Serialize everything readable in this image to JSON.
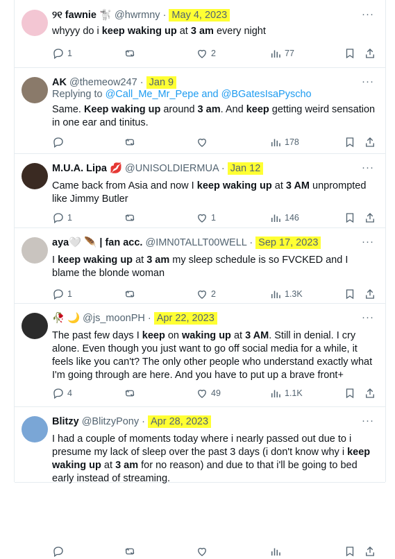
{
  "tweets": [
    {
      "name": "୨୧ fawnie 🐩",
      "handle": "@hwrmny",
      "sep": "·",
      "date": "May 4, 2023",
      "reply_prefix": "",
      "reply_to": "",
      "text": [
        [
          "whyyy do i ",
          false
        ],
        [
          "keep waking up",
          true
        ],
        [
          " at ",
          false
        ],
        [
          "3 am",
          true
        ],
        [
          " every night",
          false
        ]
      ],
      "replies": "1",
      "retweets": "",
      "likes": "2",
      "views": "77",
      "avatar_color": "#f3c6d3"
    },
    {
      "name": "AK",
      "handle": "@themeow247",
      "sep": "·",
      "date": "Jan 9",
      "reply_prefix": "Replying to ",
      "reply_to": "@Call_Me_Mr_Pepe and @BGatesIsaPyscho",
      "text": [
        [
          "Same. ",
          false
        ],
        [
          "Keep waking up",
          true
        ],
        [
          " around ",
          false
        ],
        [
          "3 am",
          true
        ],
        [
          ". And ",
          false
        ],
        [
          "keep",
          true
        ],
        [
          " getting weird sensation in one ear and tinitus.",
          false
        ]
      ],
      "replies": "",
      "retweets": "",
      "likes": "",
      "views": "178",
      "avatar_color": "#8a7a6a"
    },
    {
      "name": "M.U.A. Lipa 💋",
      "handle": "@UNISOLDIERMUA",
      "sep": "·",
      "date": "Jan 12",
      "reply_prefix": "",
      "reply_to": "",
      "text": [
        [
          "Came back from Asia and now I ",
          false
        ],
        [
          "keep waking up",
          true
        ],
        [
          " at ",
          false
        ],
        [
          "3 AM",
          true
        ],
        [
          " unprompted like Jimmy Butler",
          false
        ]
      ],
      "replies": "1",
      "retweets": "",
      "likes": "1",
      "views": "146",
      "avatar_color": "#3a2a22"
    },
    {
      "name": "aya🤍 🪶 | fan acc.",
      "handle": "@IMN0TALLT00WELL",
      "sep": "·",
      "date": "Sep 17, 2023",
      "reply_prefix": "",
      "reply_to": "",
      "text": [
        [
          "I ",
          false
        ],
        [
          "keep waking up",
          true
        ],
        [
          " at ",
          false
        ],
        [
          "3 am",
          true
        ],
        [
          " my sleep schedule is so FVCKED and I blame the blonde woman",
          false
        ]
      ],
      "replies": "1",
      "retweets": "",
      "likes": "2",
      "views": "1.3K",
      "avatar_color": "#c9c4bf"
    },
    {
      "name": "🥀 🌙",
      "handle": "@js_moonPH",
      "sep": "·",
      "date": "Apr 22, 2023",
      "reply_prefix": "",
      "reply_to": "",
      "text": [
        [
          "The past few days I ",
          false
        ],
        [
          "keep",
          true
        ],
        [
          " on ",
          false
        ],
        [
          "waking up",
          true
        ],
        [
          " at ",
          false
        ],
        [
          "3 AM",
          true
        ],
        [
          ". Still in denial. I cry alone. Even though you just want to go off social media for a while, it feels like you can't? The only other people who understand exactly what I'm going through are here. And you have to put up a brave front+",
          false
        ]
      ],
      "replies": "4",
      "retweets": "",
      "likes": "49",
      "views": "1.1K",
      "avatar_color": "#2b2b2b"
    },
    {
      "name": "Blitzy",
      "handle": "@BlitzyPony",
      "sep": "·",
      "date": "Apr 28, 2023",
      "reply_prefix": "",
      "reply_to": "",
      "text": [
        [
          "I had a couple of moments today where i nearly passed out due to i presume my lack of sleep over the past 3 days (i don't know why i ",
          false
        ],
        [
          "keep waking up",
          true
        ],
        [
          " at ",
          false
        ],
        [
          "3 am",
          true
        ],
        [
          " for no reason) and due to that i'll be going to bed early instead of streaming.",
          false
        ]
      ],
      "replies": "",
      "retweets": "",
      "likes": "",
      "views": "",
      "avatar_color": "#7aa6d6"
    }
  ],
  "more_label": "···"
}
